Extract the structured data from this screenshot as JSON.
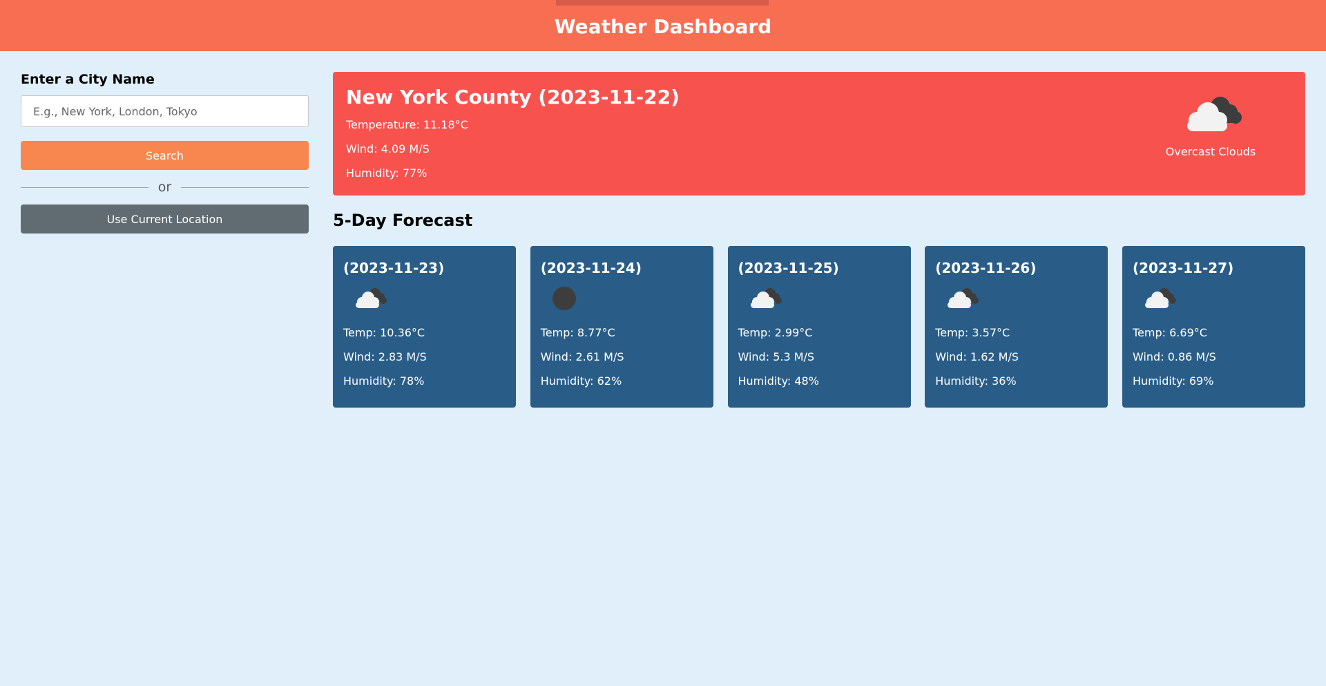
{
  "header": {
    "title": "Weather Dashboard"
  },
  "sidebar": {
    "heading": "Enter a City Name",
    "input_placeholder": "E.g., New York, London, Tokyo",
    "input_value": "",
    "search_label": "Search",
    "divider_text": "or",
    "location_label": "Use Current Location"
  },
  "current": {
    "title": "New York County (2023-11-22)",
    "temperature": "Temperature: 11.18°C",
    "wind": "Wind: 4.09 M/S",
    "humidity": "Humidity: 77%",
    "icon": "overcast-clouds-icon",
    "description": "Overcast Clouds"
  },
  "forecast": {
    "title": "5-Day Forecast",
    "days": [
      {
        "date": "(2023-11-23)",
        "icon": "clouds-icon",
        "temp": "Temp: 10.36°C",
        "wind": "Wind: 2.83 M/S",
        "humidity": "Humidity: 78%"
      },
      {
        "date": "(2023-11-24)",
        "icon": "dark-circle-icon",
        "temp": "Temp: 8.77°C",
        "wind": "Wind: 2.61 M/S",
        "humidity": "Humidity: 62%"
      },
      {
        "date": "(2023-11-25)",
        "icon": "clouds-icon",
        "temp": "Temp: 2.99°C",
        "wind": "Wind: 5.3 M/S",
        "humidity": "Humidity: 48%"
      },
      {
        "date": "(2023-11-26)",
        "icon": "clouds-icon",
        "temp": "Temp: 3.57°C",
        "wind": "Wind: 1.62 M/S",
        "humidity": "Humidity: 36%"
      },
      {
        "date": "(2023-11-27)",
        "icon": "clouds-icon",
        "temp": "Temp: 6.69°C",
        "wind": "Wind: 0.86 M/S",
        "humidity": "Humidity: 69%"
      }
    ]
  },
  "colors": {
    "header_bg": "#f76e53",
    "page_bg": "#e0effa",
    "current_bg": "#f8524f",
    "card_bg": "#295d87",
    "search_btn": "#f7874f",
    "location_btn": "#616c72"
  }
}
